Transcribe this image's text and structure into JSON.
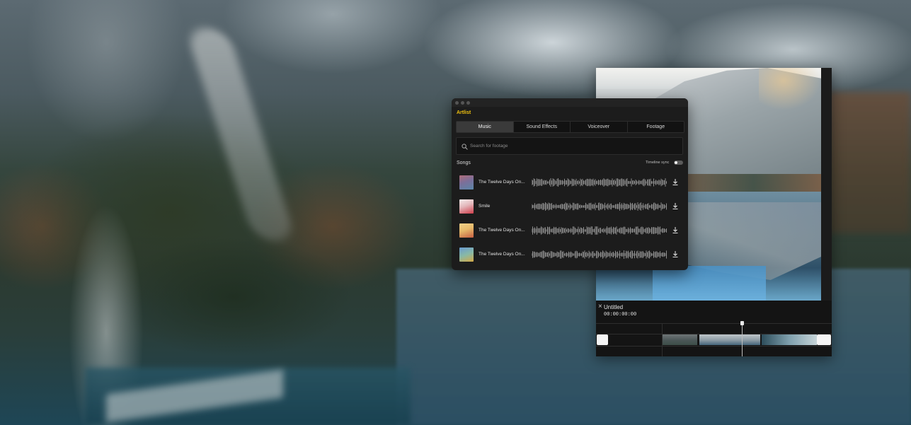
{
  "panel": {
    "brand": "Artlist",
    "tabs": [
      {
        "label": "Music",
        "active": true
      },
      {
        "label": "Sound Effects",
        "active": false
      },
      {
        "label": "Voiceover",
        "active": false
      },
      {
        "label": "Footage",
        "active": false
      }
    ],
    "search": {
      "placeholder": "Search for footage",
      "icon": "search-icon"
    },
    "section_title": "Songs",
    "timeline_sync": {
      "label": "Timeline sync",
      "enabled": false
    },
    "songs": [
      {
        "title": "The Twelve Days On...",
        "cover_colors": [
          "#7b6f9a",
          "#c98b7c"
        ],
        "action_icon": "download-icon"
      },
      {
        "title": "Smile",
        "cover_colors": [
          "#f1e6e6",
          "#cf3d4a"
        ],
        "action_icon": "download-icon"
      },
      {
        "title": "The Twelve Days On...",
        "cover_colors": [
          "#e7b96a",
          "#c65f43"
        ],
        "action_icon": "download-icon"
      },
      {
        "title": "The Twelve Days On...",
        "cover_colors": [
          "#6a9bd1",
          "#d5a945"
        ],
        "action_icon": "download-icon"
      }
    ]
  },
  "editor": {
    "close_icon": "×",
    "project_title": "Untitled",
    "timecode": "00:00:00:00"
  },
  "colors": {
    "brand_accent": "#f1c20f",
    "panel_bg": "#1c1c1c",
    "editor_bg": "#141414"
  }
}
